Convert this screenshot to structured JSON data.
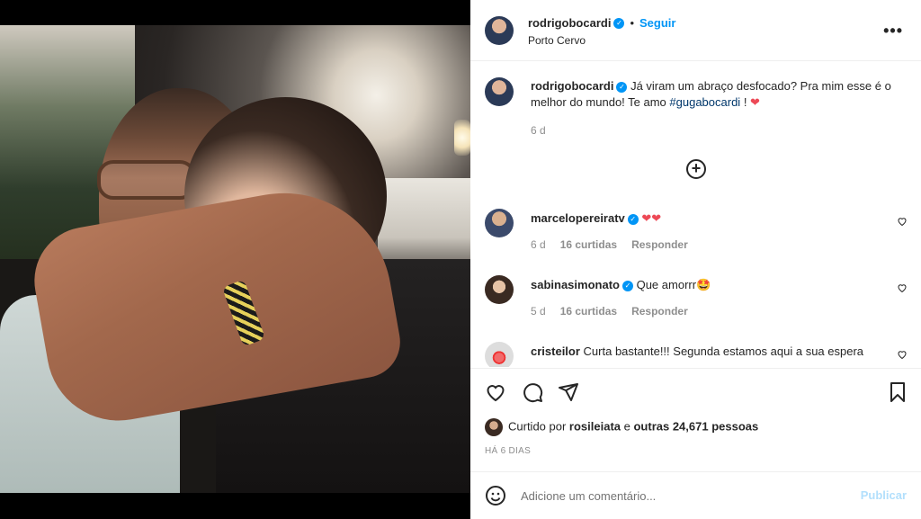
{
  "post": {
    "author": "rodrigobocardi",
    "follow_label": "Seguir",
    "separator": "•",
    "location": "Porto Cervo",
    "more_label": "•••"
  },
  "caption": {
    "username": "rodrigobocardi",
    "text_before": "Já viram um abraço desfocado? Pra mim esse é o melhor do mundo! Te amo ",
    "hashtag": "#gugabocardi",
    "text_after": " ! ",
    "heart": "❤",
    "age": "6 d"
  },
  "load_more": "+",
  "comments": [
    {
      "username": "marcelopereiratv",
      "text": "❤❤",
      "age": "6 d",
      "likes": "16 curtidas",
      "reply": "Responder"
    },
    {
      "username": "sabinasimonato",
      "text": "Que amorrr🤩",
      "age": "5 d",
      "likes": "16 curtidas",
      "reply": "Responder"
    },
    {
      "username": "cristeilor",
      "text": "Curta bastante!!! Segunda estamos aqui a sua espera"
    }
  ],
  "likes": {
    "prefix": "Curtido por ",
    "user": "rosileiata",
    "mid": " e ",
    "others": "outras 24,671 pessoas"
  },
  "time_ago": "HÁ 6 DIAS",
  "comment_box": {
    "placeholder": "Adicione um comentário...",
    "publish_label": "Publicar"
  },
  "colors": {
    "accent": "#0095f6",
    "heart": "#ed4956",
    "publish_disabled": "#b2dffc"
  }
}
